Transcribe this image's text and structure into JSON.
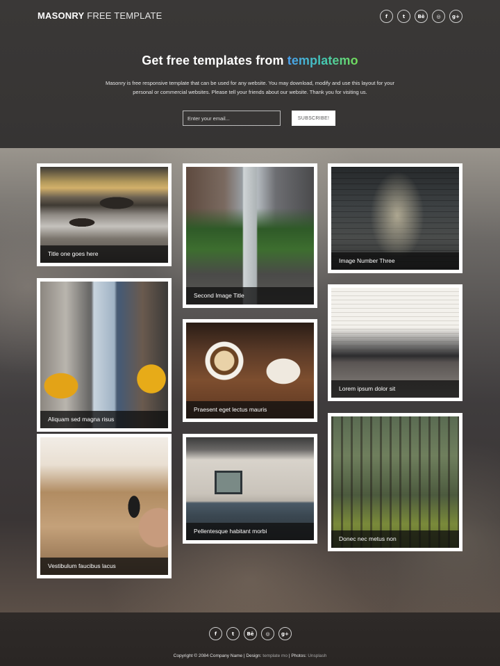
{
  "header": {
    "logo_bold": "MASONRY",
    "logo_light": "FREE TEMPLATE",
    "social": [
      {
        "icon": "facebook-icon",
        "glyph": "f"
      },
      {
        "icon": "twitter-icon",
        "glyph": "t"
      },
      {
        "icon": "behance-icon",
        "glyph": "Bē"
      },
      {
        "icon": "dribbble-icon",
        "glyph": "◎"
      },
      {
        "icon": "google-plus-icon",
        "glyph": "g+"
      }
    ],
    "headline_prefix": "Get free templates from ",
    "headline_brand": "templatemo",
    "description": "Masonry is free responsive template that can be used for any website. You may download, modify and use this layout for your personal or commercial websites. Please tell your friends about our website. Thank you for visiting us.",
    "email_placeholder": "Enter your email...",
    "subscribe_label": "SUBSCRIBE!"
  },
  "gallery": [
    {
      "caption": "Title one goes here"
    },
    {
      "caption": "Second Image Title"
    },
    {
      "caption": "Image Number Three"
    },
    {
      "caption": "Aliquam sed magna risus"
    },
    {
      "caption": "Praesent eget lectus mauris"
    },
    {
      "caption": "Lorem ipsum dolor sit"
    },
    {
      "caption": "Vestibulum faucibus lacus"
    },
    {
      "caption": "Pellentesque habitant morbi"
    },
    {
      "caption": "Donec nec metus non"
    }
  ],
  "footer": {
    "copyright_prefix": "Copyright © 2084 Company Name | Design: ",
    "design_link": "template mo",
    "photos_prefix": " | Photos: ",
    "photos_link": "Unsplash"
  },
  "colors": {
    "header_bg": "#373534",
    "brand_gradient_start": "#4aa0f0",
    "brand_gradient_end": "#74dd57",
    "caption_bg": "#0f0f0f"
  }
}
